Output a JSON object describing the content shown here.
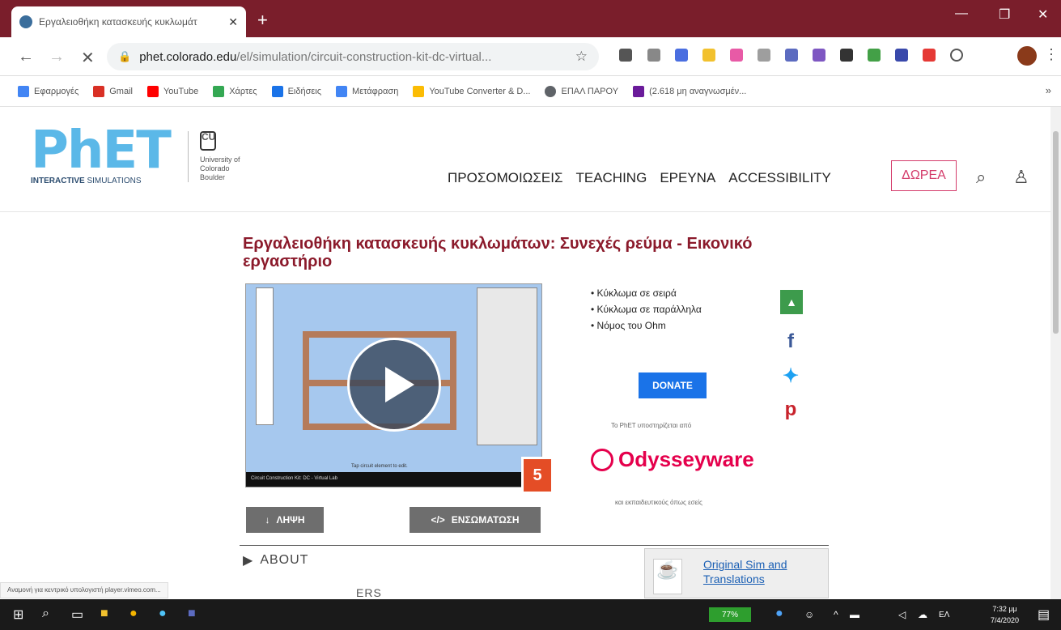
{
  "browser": {
    "tab_title": "Εργαλειοθήκη κατασκευής κυκλωμάτ",
    "url_host": "phet.colorado.edu",
    "url_path": "/el/simulation/circuit-construction-kit-dc-virtual...",
    "bookmarks": [
      {
        "label": "Εφαρμογές",
        "color": "#4285f4"
      },
      {
        "label": "Gmail",
        "color": "#d93025"
      },
      {
        "label": "YouTube",
        "color": "#ff0000"
      },
      {
        "label": "Χάρτες",
        "color": "#34a853"
      },
      {
        "label": "Ειδήσεις",
        "color": "#1a73e8"
      },
      {
        "label": "Μετάφραση",
        "color": "#4285f4"
      },
      {
        "label": "YouTube Converter & D...",
        "color": "#fbbc04"
      },
      {
        "label": "ΕΠΑΛ ΠΑΡΟΥ",
        "color": "#5f6368"
      },
      {
        "label": "(2.618 μη αναγνωσμέν...",
        "color": "#6a1b9a"
      }
    ]
  },
  "header": {
    "logo_big": "PhET",
    "logo_small_bold": "INTERACTIVE",
    "logo_small_rest": "SIMULATIONS",
    "cu_text": "University of Colorado Boulder",
    "menu": [
      "ΠΡΟΣΟΜΟΙΩΣΕΙΣ",
      "TEACHING",
      "ΕΡΕΥΝΑ",
      "ACCESSIBILITY"
    ],
    "donate_label": "ΔΩΡΕΑ"
  },
  "main": {
    "title": "Εργαλειοθήκη κατασκευής κυκλωμάτων: Συνεχές ρεύμα - Εικονικό εργαστήριο",
    "sim_caption": "Circuit Construction Kit: DC - Virtual Lab",
    "sim_tap": "Tap circuit element to edit.",
    "html5_label": "5",
    "download_label": "ΛΗΨΗ",
    "embed_label": "ΕΝΣΩΜΑΤΩΣΗ",
    "topics": [
      "Κύκλωμα σε σειρά",
      "Κύκλωμα σε παράλληλα",
      "Νόμος του Ohm"
    ],
    "donate_button": "DONATE",
    "support_text": "Το PhET υποστηρίζεται από",
    "sponsor": "Odysseyware",
    "edu_text": "και εκπαιδευτικούς όπως εσείς",
    "about_label": "ABOUT",
    "ers_label": "ERS",
    "orig_link": "Original Sim and Translations",
    "status_text": "Αναμονή για κεντρικό υπολογιστή player.vimeo.com..."
  },
  "taskbar": {
    "battery": "77%",
    "lang": "ΕΛ",
    "time": "7:32 μμ",
    "date": "7/4/2020"
  }
}
